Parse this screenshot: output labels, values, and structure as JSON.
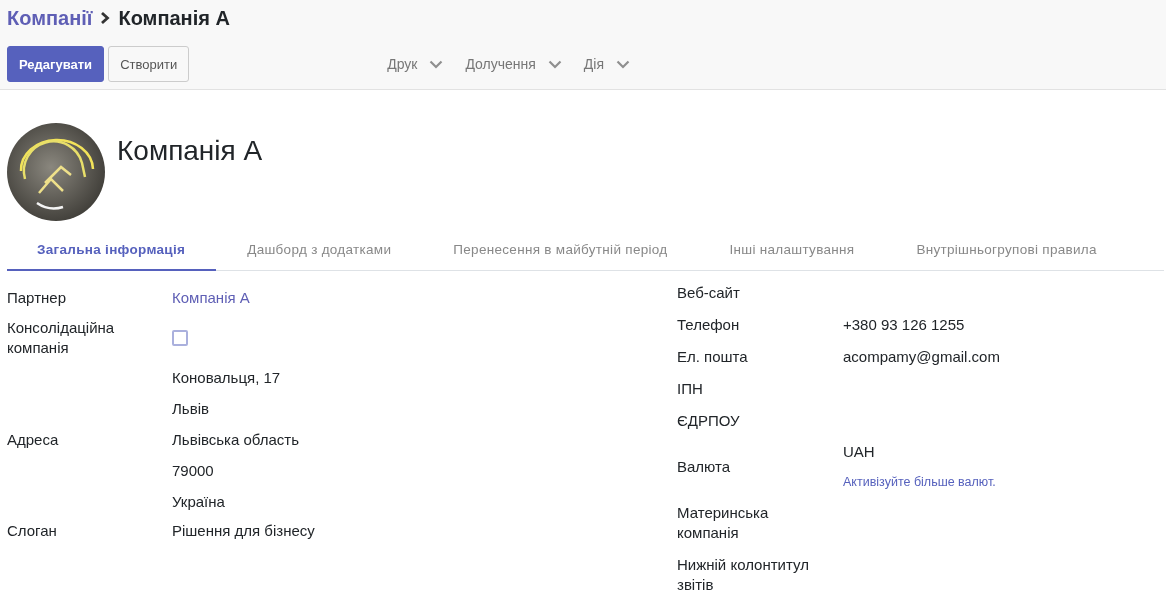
{
  "breadcrumb": [
    {
      "label": "Компанії",
      "kind": "link"
    },
    {
      "label": "Компанія А",
      "kind": "current"
    }
  ],
  "buttons": [
    {
      "label": "Редагувати",
      "kind": "primary"
    },
    {
      "label": "Створити",
      "kind": "secondary"
    }
  ],
  "dropdowns": [
    "Друк",
    "Долучення",
    "Дія"
  ],
  "record": {
    "name": "Компанія А"
  },
  "tabs": [
    {
      "label": "Загальна інформація",
      "selected": true
    },
    {
      "label": "Дашборд з додатками",
      "selected": false
    },
    {
      "label": "Перенесення в майбутній період",
      "selected": false
    },
    {
      "label": "Інші налаштування",
      "selected": false
    },
    {
      "label": "Внутрішньогрупові правила",
      "selected": false
    }
  ],
  "left_fields": [
    {
      "label": "Партнер",
      "kind": "link",
      "value": "Компанія А"
    },
    {
      "label": "Консолідаційна компанія",
      "kind": "checkbox",
      "checked": false
    },
    {
      "label": "Адреса",
      "kind": "address",
      "lines": [
        "Коновальця, 17",
        "Львів",
        "Львівська область",
        "79000",
        "Україна"
      ]
    },
    {
      "label": "Слоган",
      "kind": "text",
      "value": "Рішення для бізнесу"
    }
  ],
  "right_fields": [
    {
      "label": "Веб-сайт",
      "kind": "text"
    },
    {
      "label": "Телефон",
      "kind": "text",
      "value": "+380 93 126 1255"
    },
    {
      "label": "Ел. пошта",
      "kind": "text",
      "value": "acompamy@gmail.com"
    },
    {
      "label": "ІПН",
      "kind": "text"
    },
    {
      "label": "ЄДРПОУ",
      "kind": "text"
    },
    {
      "label": "Валюта",
      "kind": "text",
      "value": "UAH",
      "hint": "Активізуйте більше валют."
    },
    {
      "label": "Материнська компанія",
      "kind": "text"
    },
    {
      "label": "Нижній колонтитул звітів",
      "kind": "text"
    }
  ]
}
